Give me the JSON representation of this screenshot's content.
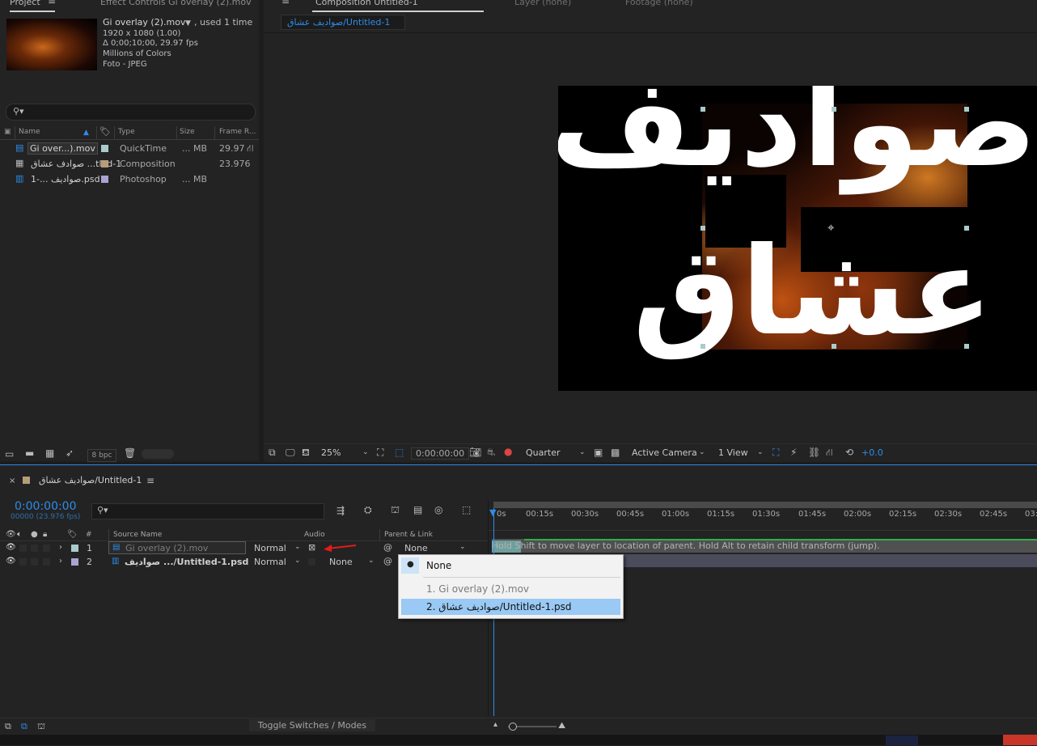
{
  "project": {
    "tabs": [
      "Project",
      "Effect Controls Gi overlay (2).mov"
    ],
    "footage_name": "Gi overlay (2).mov",
    "used_text": ", used 1 time",
    "info_lines": [
      "1920 x 1080 (1.00)",
      "Δ 0;00;10;00, 29.97 fps",
      "Millions of Colors",
      "Foto - JPEG"
    ],
    "columns": [
      "Name",
      "Type",
      "Size",
      "Frame R..."
    ],
    "items": [
      {
        "name": "Gi over...).mov",
        "type": "QuickTime",
        "size": "... MB",
        "fps": "29.97",
        "color": "#a9cbcb"
      },
      {
        "name": "صوادف عشاق ...tled-1",
        "type": "Composition",
        "size": "",
        "fps": "23.976",
        "color": "#b89d79"
      },
      {
        "name": "صواديف ...-1.psd",
        "type": "Photoshop",
        "size": "... MB",
        "fps": "",
        "color": "#a9a3d3"
      }
    ],
    "bpc": "8 bpc"
  },
  "viewer": {
    "tabs": [
      "Composition Untitled-1",
      "Layer (none)",
      "Footage (none)"
    ],
    "comp_name": "صواديف عشاق/Untitled-1",
    "text_line1": "صواديف",
    "text_line2": "عشاق",
    "zoom": "25%",
    "timecode": "0:00:00:00",
    "resolution": "Quarter",
    "camera": "Active Camera",
    "views": "1 View",
    "exposure": "+0.0"
  },
  "timeline": {
    "comp_tab": "صواديف عشاق/Untitled-1",
    "timecode": "0:00:00:00",
    "frame_info": "00000 (23.976 fps)",
    "col_num": "#",
    "col_source": "Source Name",
    "col_audio": "Audio",
    "col_parent": "Parent & Link",
    "layers": [
      {
        "num": "1",
        "name": "Gi overlay (2).mov",
        "mode": "Normal",
        "parent": "None",
        "color": "#a9cbcb"
      },
      {
        "num": "2",
        "name": "صواديف .../Untitled-1.psd",
        "mode": "Normal",
        "parent": "None",
        "color": "#a9a3d3"
      }
    ],
    "ruler": [
      "0s",
      "00:15s",
      "00:30s",
      "00:45s",
      "01:00s",
      "01:15s",
      "01:30s",
      "01:45s",
      "02:00s",
      "02:15s",
      "02:30s",
      "02:45s",
      "03:"
    ],
    "hint": "Hold Shift to move layer to location of parent. Hold Alt to retain child transform (jump).",
    "toggle": "Toggle Switches / Modes"
  },
  "parent_menu": {
    "items": [
      "None",
      "1. Gi overlay (2).mov",
      "2. صواديف عشاق/Untitled-1.psd"
    ],
    "checked": 0,
    "highlighted": 2
  },
  "colors": {
    "accent": "#2d8ceb",
    "highlight": "#99c9f4",
    "arrow": "#e21b1b"
  }
}
